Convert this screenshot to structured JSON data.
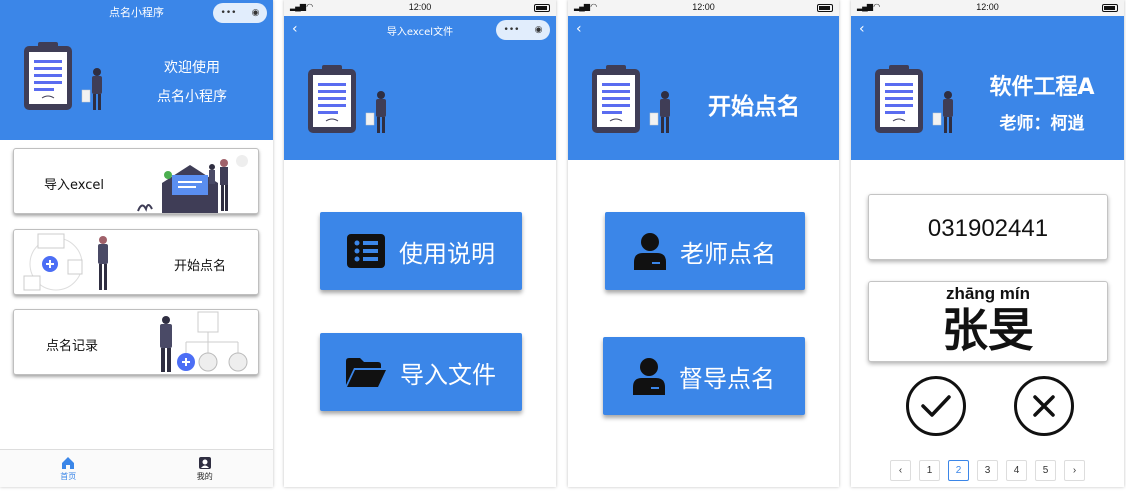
{
  "screen1": {
    "title": "点名小程序",
    "hero_line1": "欢迎使用",
    "hero_line2": "点名小程序",
    "cards": [
      {
        "label": "导入excel"
      },
      {
        "label": "开始点名"
      },
      {
        "label": "点名记录"
      }
    ],
    "tabs": [
      {
        "label": "首页",
        "icon": "home-icon",
        "active": true
      },
      {
        "label": "我的",
        "icon": "profile-icon",
        "active": false
      }
    ]
  },
  "screen2": {
    "status_time": "12:00",
    "title": "导入excel文件",
    "buttons": [
      {
        "label": "使用说明",
        "icon": "list-icon"
      },
      {
        "label": "导入文件",
        "icon": "folder-open-icon"
      }
    ]
  },
  "screen3": {
    "status_time": "12:00",
    "hero_title": "开始点名",
    "buttons": [
      {
        "label": "老师点名",
        "icon": "user-icon"
      },
      {
        "label": "督导点名",
        "icon": "user-icon"
      }
    ]
  },
  "screen4": {
    "status_time": "12:00",
    "course": "软件工程A",
    "teacher": "老师：柯逍",
    "student_id": "031902441",
    "pinyin": "zhāng mín",
    "student_name": "张旻",
    "pages": [
      "1",
      "2",
      "3",
      "4",
      "5"
    ],
    "current_page": "2",
    "prev": "‹",
    "next": "›"
  },
  "colors": {
    "accent": "#3b86e8",
    "card_border": "#bfbfbf"
  }
}
